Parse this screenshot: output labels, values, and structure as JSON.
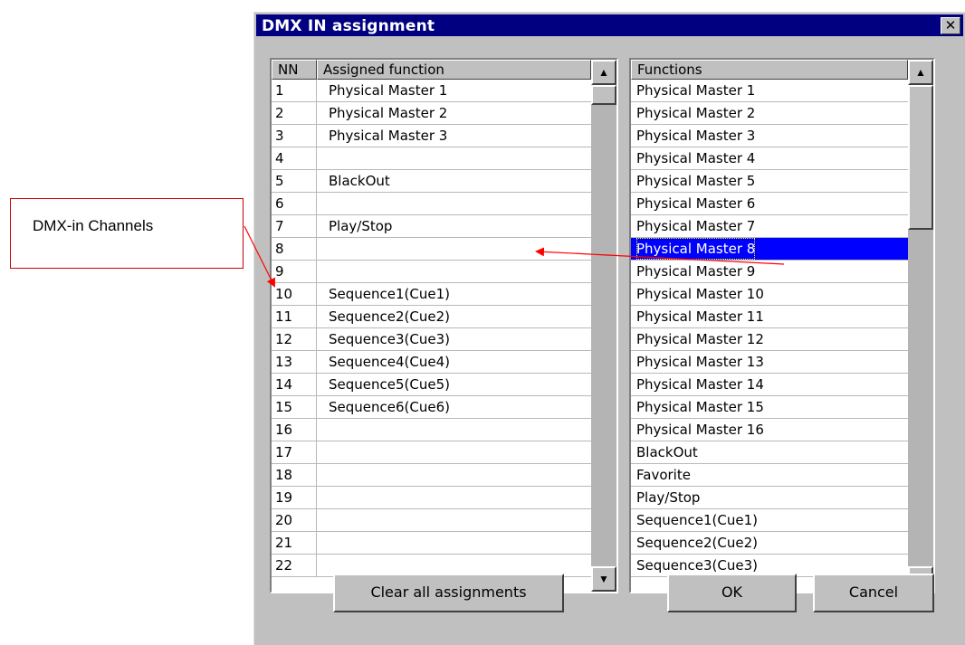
{
  "callout": {
    "text": "DMX-in Channels"
  },
  "window": {
    "title": "DMX IN assignment",
    "close_label": "✕"
  },
  "left_list": {
    "headers": {
      "nn": "NN",
      "assigned": "Assigned function"
    },
    "rows": [
      {
        "nn": "1",
        "fn": "Physical Master 1"
      },
      {
        "nn": "2",
        "fn": "Physical Master 2"
      },
      {
        "nn": "3",
        "fn": "Physical Master 3"
      },
      {
        "nn": "4",
        "fn": ""
      },
      {
        "nn": "5",
        "fn": "BlackOut"
      },
      {
        "nn": "6",
        "fn": ""
      },
      {
        "nn": "7",
        "fn": "Play/Stop"
      },
      {
        "nn": "8",
        "fn": ""
      },
      {
        "nn": "9",
        "fn": ""
      },
      {
        "nn": "10",
        "fn": "Sequence1(Cue1)"
      },
      {
        "nn": "11",
        "fn": "Sequence2(Cue2)"
      },
      {
        "nn": "12",
        "fn": "Sequence3(Cue3)"
      },
      {
        "nn": "13",
        "fn": "Sequence4(Cue4)"
      },
      {
        "nn": "14",
        "fn": "Sequence5(Cue5)"
      },
      {
        "nn": "15",
        "fn": "Sequence6(Cue6)"
      },
      {
        "nn": "16",
        "fn": ""
      },
      {
        "nn": "17",
        "fn": ""
      },
      {
        "nn": "18",
        "fn": ""
      },
      {
        "nn": "19",
        "fn": ""
      },
      {
        "nn": "20",
        "fn": ""
      },
      {
        "nn": "21",
        "fn": ""
      },
      {
        "nn": "22",
        "fn": ""
      }
    ]
  },
  "right_list": {
    "header": "Functions",
    "selected_index": 7,
    "rows": [
      "Physical Master 1",
      "Physical Master 2",
      "Physical Master 3",
      "Physical Master 4",
      "Physical Master 5",
      "Physical Master 6",
      "Physical Master 7",
      "Physical Master 8",
      "Physical Master 9",
      "Physical Master 10",
      "Physical Master 11",
      "Physical Master 12",
      "Physical Master 13",
      "Physical Master 14",
      "Physical Master 15",
      "Physical Master 16",
      "BlackOut",
      "Favorite",
      "Play/Stop",
      "Sequence1(Cue1)",
      "Sequence2(Cue2)",
      "Sequence3(Cue3)"
    ]
  },
  "buttons": {
    "clear": "Clear all assignments",
    "ok": "OK",
    "cancel": "Cancel"
  },
  "colors": {
    "title_bar": "#000080",
    "selection": "#0000ff",
    "annotation": "#ff0000"
  }
}
